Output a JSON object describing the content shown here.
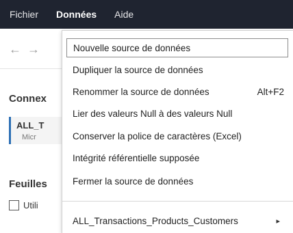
{
  "menubar": {
    "items": [
      "Fichier",
      "Données",
      "Aide"
    ]
  },
  "background": {
    "nav_back": "←",
    "nav_forward": "→",
    "connections_title": "Connex",
    "connection_name": "ALL_T",
    "connection_sub": "Micr",
    "sheets_title": "Feuilles",
    "checkbox_label": "Utili",
    "partial_text": "..."
  },
  "dropdown": {
    "items": [
      {
        "label": "Nouvelle source de données"
      },
      {
        "label": "Dupliquer la source de données"
      },
      {
        "label": "Renommer la source de données",
        "shortcut": "Alt+F2"
      },
      {
        "label": "Lier des valeurs Null à des valeurs Null"
      },
      {
        "label": "Conserver la police de caractères (Excel)"
      },
      {
        "label": "Intégrité référentielle supposée"
      },
      {
        "label": "Fermer la source de données"
      }
    ],
    "submenu_item": {
      "label": "ALL_Transactions_Products_Customers",
      "arrow": "▸"
    }
  }
}
